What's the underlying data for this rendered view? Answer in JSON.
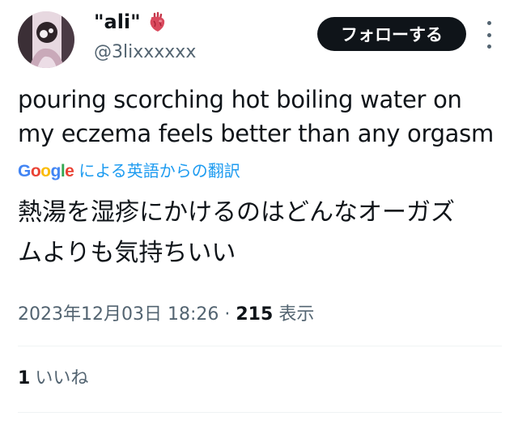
{
  "author": {
    "display_name": "\"ali\"",
    "handle": "@3lixxxxxx"
  },
  "follow_label": "フォローする",
  "tweet": {
    "lines": [
      "pouring scorching hot boiling water on",
      "my eczema feels better than any orgasm"
    ]
  },
  "translation": {
    "provider": "Google",
    "link_label": "による英語からの翻訳",
    "lines": [
      "熱湯を湿疹にかけるのはどんなオーガズ",
      "ムよりも気持ちいい"
    ]
  },
  "meta": {
    "timestamp": "2023年12月03日 18:26",
    "separator": "·",
    "views_count": "215",
    "views_label": "表示"
  },
  "likes": {
    "count": "1",
    "label": "いいね"
  },
  "colors": {
    "link": "#1d9bf0",
    "secondary_text": "#536471",
    "primary_text": "#0f1419"
  },
  "icons": [
    "anatomical-heart-icon",
    "more-options-icon",
    "google-logo"
  ]
}
